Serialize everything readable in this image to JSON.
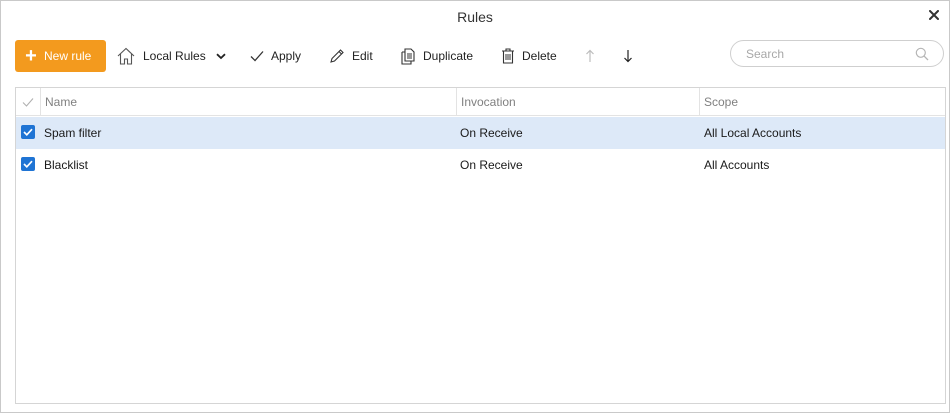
{
  "window": {
    "title": "Rules"
  },
  "toolbar": {
    "new_rule": "New rule",
    "local_rules": "Local Rules",
    "apply": "Apply",
    "edit": "Edit",
    "duplicate": "Duplicate",
    "delete": "Delete"
  },
  "search": {
    "placeholder": "Search"
  },
  "grid": {
    "columns": [
      "Name",
      "Invocation",
      "Scope"
    ],
    "rows": [
      {
        "checked": true,
        "selected": true,
        "name": "Spam filter",
        "invocation": "On Receive",
        "scope": "All Local Accounts"
      },
      {
        "checked": true,
        "selected": false,
        "name": "Blacklist",
        "invocation": "On Receive",
        "scope": "All Accounts"
      }
    ]
  },
  "colors": {
    "accent": "#f39a1e",
    "checkbox": "#1f74d4",
    "selected_row": "#dde9f8"
  },
  "icons": [
    "close-icon",
    "plus-icon",
    "home-icon",
    "chevron-down-icon",
    "check-icon",
    "pencil-icon",
    "duplicate-icon",
    "trash-icon",
    "arrow-up-icon",
    "arrow-down-icon",
    "search-icon"
  ]
}
